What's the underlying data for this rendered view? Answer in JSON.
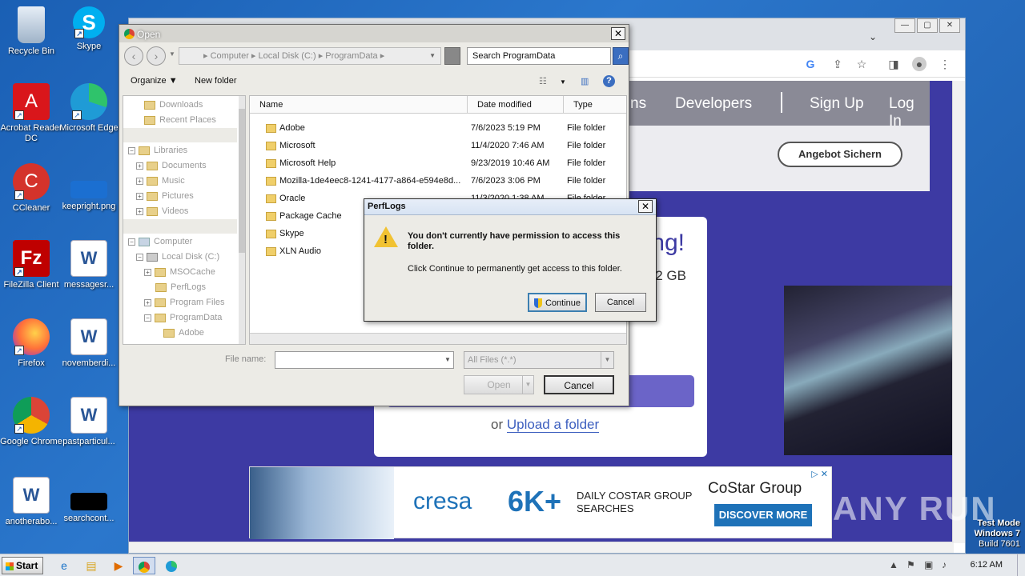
{
  "desktop": {
    "icons": [
      {
        "label": "Recycle Bin",
        "icon": "recycle-bin-icon",
        "color": "#c9d6e6"
      },
      {
        "label": "Skype",
        "icon": "skype-icon",
        "color": "#00aff0"
      },
      {
        "label": "Acrobat Reader DC",
        "icon": "acrobat-icon",
        "color": "#d9161b"
      },
      {
        "label": "Microsoft Edge",
        "icon": "edge-icon",
        "color": "#1f9bd6"
      },
      {
        "label": "CCleaner",
        "icon": "ccleaner-icon",
        "color": "#d4332b"
      },
      {
        "label": "keepright.png",
        "icon": "image-file-icon",
        "color": "#1b6fd1"
      },
      {
        "label": "FileZilla Client",
        "icon": "filezilla-icon",
        "color": "#bf0000"
      },
      {
        "label": "messagesr...",
        "icon": "word-doc-icon",
        "color": "#2b5797"
      },
      {
        "label": "Firefox",
        "icon": "firefox-icon",
        "color": "#ff7139"
      },
      {
        "label": "novemberdi...",
        "icon": "word-doc-icon",
        "color": "#2b5797"
      },
      {
        "label": "Google Chrome",
        "icon": "chrome-icon",
        "color": "#db4437"
      },
      {
        "label": "pastparticul...",
        "icon": "word-doc-icon",
        "color": "#2b5797"
      },
      {
        "label": "anotherabo...",
        "icon": "word-doc-icon",
        "color": "#2b5797"
      },
      {
        "label": "searchcont...",
        "icon": "black-file-icon",
        "color": "#000000"
      }
    ],
    "watermark": {
      "text": "ANY RUN",
      "test_mode_line1": "Test Mode",
      "test_mode_line2": "Windows 7",
      "test_mode_line3": "Build 7601"
    }
  },
  "browser": {
    "window_buttons": [
      "—",
      "▢",
      "✕"
    ],
    "nav_links": [
      "ns",
      "Developers",
      "Sign Up",
      "Log In"
    ],
    "angebot_button": "Angebot Sichern",
    "headline_tail": "ng!",
    "size_tail": "2 GB",
    "upload_prefix": "or",
    "upload_link": "Upload a folder",
    "ad": {
      "brand": "cresa",
      "big_number": "6K+",
      "tagline_line1": "DAILY COSTAR GROUP",
      "tagline_line2": "SEARCHES",
      "partner": "CoStar Group",
      "cta": "DISCOVER MORE",
      "ad_choices": "▷ ✕"
    }
  },
  "open_dialog": {
    "title": "Open",
    "close_label": "✕",
    "breadcrumb": "▸ Computer ▸ Local Disk (C:) ▸ ProgramData ▸",
    "search_value": "Search ProgramData",
    "organize_label": "Organize ▼",
    "new_folder_label": "New folder",
    "nav_tree": [
      {
        "label": "Downloads",
        "expander": ""
      },
      {
        "label": "Recent Places",
        "expander": ""
      },
      {
        "label": "Libraries",
        "expander": "−"
      },
      {
        "label": "Documents",
        "expander": "+"
      },
      {
        "label": "Music",
        "expander": "+"
      },
      {
        "label": "Pictures",
        "expander": "+"
      },
      {
        "label": "Videos",
        "expander": "+"
      },
      {
        "label": "Computer",
        "expander": "−"
      },
      {
        "label": "Local Disk (C:)",
        "expander": "−"
      },
      {
        "label": "MSOCache",
        "expander": "+"
      },
      {
        "label": "PerfLogs",
        "expander": ""
      },
      {
        "label": "Program Files",
        "expander": "+"
      },
      {
        "label": "ProgramData",
        "expander": "−"
      },
      {
        "label": "Adobe",
        "expander": ""
      }
    ],
    "columns": {
      "name": "Name",
      "date": "Date modified",
      "type": "Type"
    },
    "files": [
      {
        "name": "Adobe",
        "date": "7/6/2023 5:19 PM",
        "type": "File folder"
      },
      {
        "name": "Microsoft",
        "date": "11/4/2020 7:46 AM",
        "type": "File folder"
      },
      {
        "name": "Microsoft Help",
        "date": "9/23/2019 10:46 AM",
        "type": "File folder"
      },
      {
        "name": "Mozilla-1de4eec8-1241-4177-a864-e594e8d...",
        "date": "7/6/2023 3:06 PM",
        "type": "File folder"
      },
      {
        "name": "Oracle",
        "date": "11/3/2020 1:38 AM",
        "type": "File folder"
      },
      {
        "name": "Package Cache",
        "date": "",
        "type": ""
      },
      {
        "name": "Skype",
        "date": "",
        "type": ""
      },
      {
        "name": "XLN Audio",
        "date": "",
        "type": ""
      }
    ],
    "file_name_label": "File name:",
    "file_name_value": "",
    "file_type_value": "All Files (*.*)",
    "open_button": "Open",
    "cancel_button": "Cancel"
  },
  "message_box": {
    "title": "PerfLogs",
    "close_label": "✕",
    "heading": "You don't currently have permission to access this folder.",
    "body": "Click Continue to permanently get access to this folder.",
    "continue_button": "Continue",
    "cancel_button": "Cancel"
  },
  "taskbar": {
    "start_label": "Start",
    "clock": "6:12 AM",
    "pinned": [
      "ie-icon",
      "explorer-icon",
      "media-player-icon",
      "chrome-icon",
      "edge-icon"
    ]
  }
}
